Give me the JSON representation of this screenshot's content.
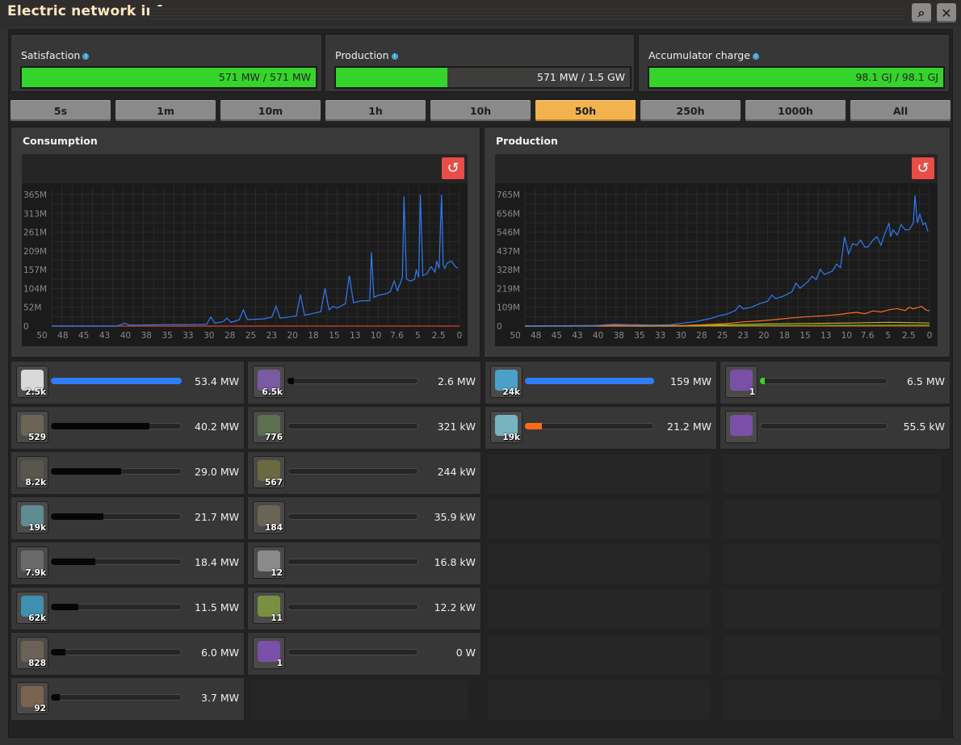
{
  "window": {
    "title": "Electric network info"
  },
  "toolbar": {
    "search_glyph": "⌕",
    "close_glyph": "✕"
  },
  "stats": {
    "satisfaction": {
      "label": "Satisfaction",
      "value": "571 MW / 571 MW",
      "fraction": 1.0
    },
    "production": {
      "label": "Production",
      "value": "571 MW / 1.5 GW",
      "fraction": 0.38
    },
    "accumulator": {
      "label": "Accumulator charge",
      "value": "98.1 GJ / 98.1 GJ",
      "fraction": 1.0
    }
  },
  "time_tabs": {
    "items": [
      "5s",
      "1m",
      "10m",
      "1h",
      "10h",
      "50h",
      "250h",
      "1000h",
      "All"
    ],
    "active": "50h"
  },
  "colors": {
    "accent_green": "#35d42a",
    "active_tab": "#f2b34e",
    "reset_red": "#e84d48",
    "line_blue": "#2f7cf6",
    "line_orange": "#ff6a1a",
    "line_yellow": "#c8b020",
    "line_green": "#5fbf2a"
  },
  "chart_data": [
    {
      "type": "line",
      "title": "Consumption",
      "xlabel": "",
      "ylabel": "",
      "x_tick_labels": [
        "50",
        "48",
        "45",
        "43",
        "40",
        "38",
        "35",
        "33",
        "30",
        "28",
        "25",
        "23",
        "20",
        "18",
        "15",
        "13",
        "10",
        "7.6",
        "5",
        "2.5",
        "0"
      ],
      "y_tick_labels": [
        "0",
        "52M",
        "104M",
        "157M",
        "209M",
        "261M",
        "313M",
        "365M"
      ],
      "xlim": [
        50,
        0
      ],
      "ylim": [
        0,
        365
      ],
      "grid": true,
      "series": [
        {
          "color": "#2f7cf6",
          "points": [
            [
              50,
              0
            ],
            [
              47,
              0
            ],
            [
              44,
              0
            ],
            [
              42,
              0
            ],
            [
              41,
              8
            ],
            [
              40.5,
              3
            ],
            [
              39,
              3
            ],
            [
              36,
              4
            ],
            [
              33,
              4
            ],
            [
              31,
              5
            ],
            [
              30.5,
              25
            ],
            [
              30,
              8
            ],
            [
              29,
              12
            ],
            [
              28.5,
              22
            ],
            [
              28,
              10
            ],
            [
              27,
              18
            ],
            [
              26.5,
              45
            ],
            [
              26,
              18
            ],
            [
              24,
              20
            ],
            [
              23,
              25
            ],
            [
              22.5,
              55
            ],
            [
              22,
              22
            ],
            [
              21,
              25
            ],
            [
              20,
              28
            ],
            [
              19.5,
              88
            ],
            [
              19,
              30
            ],
            [
              18,
              35
            ],
            [
              17,
              40
            ],
            [
              16.5,
              105
            ],
            [
              16,
              45
            ],
            [
              15.5,
              55
            ],
            [
              15,
              50
            ],
            [
              14,
              62
            ],
            [
              13.5,
              140
            ],
            [
              13,
              65
            ],
            [
              12,
              70
            ],
            [
              11.5,
              70
            ],
            [
              11,
              70
            ],
            [
              10.8,
              205
            ],
            [
              10.5,
              80
            ],
            [
              10,
              85
            ],
            [
              9,
              90
            ],
            [
              8.5,
              95
            ],
            [
              8,
              125
            ],
            [
              7.6,
              98
            ],
            [
              7,
              135
            ],
            [
              6.8,
              360
            ],
            [
              6.5,
              130
            ],
            [
              6,
              125
            ],
            [
              5.5,
              130
            ],
            [
              5.3,
              155
            ],
            [
              5,
              135
            ],
            [
              4.8,
              365
            ],
            [
              4.5,
              140
            ],
            [
              4,
              145
            ],
            [
              3.5,
              165
            ],
            [
              3,
              150
            ],
            [
              2.8,
              180
            ],
            [
              2.5,
              160
            ],
            [
              2.2,
              365
            ],
            [
              2,
              170
            ],
            [
              1.8,
              160
            ],
            [
              1.5,
              175
            ],
            [
              1,
              180
            ],
            [
              0.5,
              165
            ],
            [
              0.2,
              160
            ]
          ]
        }
      ]
    },
    {
      "type": "line",
      "title": "Production",
      "xlabel": "",
      "ylabel": "",
      "x_tick_labels": [
        "50",
        "48",
        "45",
        "43",
        "40",
        "38",
        "35",
        "33",
        "30",
        "28",
        "25",
        "23",
        "20",
        "18",
        "15",
        "13",
        "10",
        "7.6",
        "5",
        "2.5",
        "0"
      ],
      "y_tick_labels": [
        "0",
        "109M",
        "219M",
        "328M",
        "437M",
        "546M",
        "656M",
        "765M"
      ],
      "xlim": [
        50,
        0
      ],
      "ylim": [
        0,
        765
      ],
      "grid": true,
      "series": [
        {
          "color": "#2f7cf6",
          "points": [
            [
              50,
              0
            ],
            [
              42,
              0
            ],
            [
              40,
              8
            ],
            [
              39,
              10
            ],
            [
              36,
              8
            ],
            [
              34,
              6
            ],
            [
              32,
              8
            ],
            [
              30,
              20
            ],
            [
              29,
              25
            ],
            [
              28,
              35
            ],
            [
              27,
              45
            ],
            [
              26,
              60
            ],
            [
              25,
              70
            ],
            [
              24,
              90
            ],
            [
              23.5,
              120
            ],
            [
              23,
              100
            ],
            [
              22,
              110
            ],
            [
              21,
              130
            ],
            [
              20,
              145
            ],
            [
              19.5,
              180
            ],
            [
              19,
              160
            ],
            [
              18,
              175
            ],
            [
              17,
              200
            ],
            [
              16.5,
              250
            ],
            [
              16,
              220
            ],
            [
              15,
              260
            ],
            [
              14.5,
              290
            ],
            [
              14,
              270
            ],
            [
              13.5,
              330
            ],
            [
              13,
              300
            ],
            [
              12,
              320
            ],
            [
              11.5,
              360
            ],
            [
              11,
              340
            ],
            [
              10.5,
              520
            ],
            [
              10,
              420
            ],
            [
              9.5,
              480
            ],
            [
              9,
              470
            ],
            [
              8.5,
              500
            ],
            [
              8,
              460
            ],
            [
              7.6,
              460
            ],
            [
              7,
              500
            ],
            [
              6.5,
              520
            ],
            [
              6,
              470
            ],
            [
              5.5,
              540
            ],
            [
              5,
              600
            ],
            [
              4.8,
              520
            ],
            [
              4.5,
              560
            ],
            [
              4,
              530
            ],
            [
              3.5,
              590
            ],
            [
              3,
              560
            ],
            [
              2.5,
              560
            ],
            [
              2,
              600
            ],
            [
              1.8,
              760
            ],
            [
              1.5,
              600
            ],
            [
              1.2,
              650
            ],
            [
              1,
              620
            ],
            [
              0.8,
              590
            ],
            [
              0.5,
              600
            ],
            [
              0.2,
              550
            ]
          ]
        },
        {
          "color": "#ff6a1a",
          "points": [
            [
              50,
              0
            ],
            [
              30,
              4
            ],
            [
              28,
              8
            ],
            [
              25,
              15
            ],
            [
              23,
              25
            ],
            [
              21,
              30
            ],
            [
              19,
              38
            ],
            [
              17,
              48
            ],
            [
              15,
              55
            ],
            [
              13,
              60
            ],
            [
              11,
              68
            ],
            [
              10,
              75
            ],
            [
              9,
              80
            ],
            [
              8,
              72
            ],
            [
              7,
              88
            ],
            [
              6,
              82
            ],
            [
              5,
              95
            ],
            [
              4,
              102
            ],
            [
              3,
              90
            ],
            [
              2.5,
              110
            ],
            [
              2,
              100
            ],
            [
              1,
              115
            ],
            [
              0.5,
              95
            ],
            [
              0,
              88
            ]
          ]
        },
        {
          "color": "#c8b020",
          "points": [
            [
              50,
              0
            ],
            [
              30,
              2
            ],
            [
              25,
              8
            ],
            [
              20,
              12
            ],
            [
              15,
              15
            ],
            [
              10,
              18
            ],
            [
              5,
              22
            ],
            [
              2.5,
              20
            ],
            [
              0,
              18
            ]
          ]
        },
        {
          "color": "#5fbf2a",
          "points": [
            [
              50,
              0
            ],
            [
              38,
              4
            ],
            [
              36,
              0
            ],
            [
              30,
              1
            ],
            [
              20,
              3
            ],
            [
              10,
              4
            ],
            [
              5,
              5
            ],
            [
              0,
              5
            ]
          ]
        }
      ]
    }
  ],
  "consumption_rows": [
    {
      "icon": "radar-icon",
      "icon_color": "#d9d9d9",
      "count": "2.5k",
      "value": "53.4 MW",
      "fraction": 1.0,
      "bar_color": "#2f7cf6"
    },
    {
      "icon": "roboport-icon",
      "icon_color": "#6b6558",
      "count": "529",
      "value": "40.2 MW",
      "fraction": 0.75,
      "bar_color": "#060606"
    },
    {
      "icon": "electric-furnace-icon",
      "icon_color": "#5a564e",
      "count": "8.2k",
      "value": "29.0 MW",
      "fraction": 0.54,
      "bar_color": "#060606"
    },
    {
      "icon": "beacon-icon",
      "icon_color": "#5f8c90",
      "count": "19k",
      "value": "21.7 MW",
      "fraction": 0.4,
      "bar_color": "#060606"
    },
    {
      "icon": "assembler-icon",
      "icon_color": "#6a6a6a",
      "count": "7.9k",
      "value": "18.4 MW",
      "fraction": 0.34,
      "bar_color": "#060606"
    },
    {
      "icon": "stack-inserter-icon",
      "icon_color": "#3f8fb0",
      "count": "62k",
      "value": "11.5 MW",
      "fraction": 0.21,
      "bar_color": "#060606"
    },
    {
      "icon": "lab-icon",
      "icon_color": "#6b6154",
      "count": "828",
      "value": "6.0 MW",
      "fraction": 0.11,
      "bar_color": "#060606"
    },
    {
      "icon": "mining-drill-icon",
      "icon_color": "#7a6450",
      "count": "92",
      "value": "3.7 MW",
      "fraction": 0.07,
      "bar_color": "#060606"
    }
  ],
  "consumption_rows_2": [
    {
      "icon": "inserter-icon",
      "icon_color": "#7a5aa0",
      "count": "6.5k",
      "value": "2.6 MW",
      "fraction": 0.05,
      "bar_color": "#060606"
    },
    {
      "icon": "programmable-speaker-icon",
      "icon_color": "#5a7050",
      "count": "776",
      "value": "321 kW",
      "fraction": 0.0,
      "bar_color": "#060606"
    },
    {
      "icon": "arithmetic-combinator-icon",
      "icon_color": "#6a6a40",
      "count": "567",
      "value": "244 kW",
      "fraction": 0.0,
      "bar_color": "#060606"
    },
    {
      "icon": "pump-icon",
      "icon_color": "#6a6456",
      "count": "184",
      "value": "35.9 kW",
      "fraction": 0.0,
      "bar_color": "#060606"
    },
    {
      "icon": "filter-inserter-icon",
      "icon_color": "#8a8a8a",
      "count": "12",
      "value": "16.8 kW",
      "fraction": 0.0,
      "bar_color": "#060606"
    },
    {
      "icon": "fast-inserter-icon",
      "icon_color": "#7a9040",
      "count": "11",
      "value": "12.2 kW",
      "fraction": 0.0,
      "bar_color": "#060606"
    },
    {
      "icon": "accumulator-icon",
      "icon_color": "#7a4fa8",
      "count": "1",
      "value": "0 W",
      "fraction": 0.0,
      "bar_color": "#060606"
    }
  ],
  "production_rows": [
    {
      "icon": "solar-panel-icon",
      "icon_color": "#4aa0c8",
      "count": "24k",
      "value": "159 MW",
      "fraction": 1.0,
      "bar_color": "#2f7cf6"
    },
    {
      "icon": "steam-engine-icon",
      "icon_color": "#78b4c0",
      "count": "19k",
      "value": "21.2 MW",
      "fraction": 0.13,
      "bar_color": "#ff6a1a"
    }
  ],
  "production_rows_2": [
    {
      "icon": "accumulator-icon",
      "icon_color": "#7a4fa8",
      "count": "1",
      "value": "6.5 MW",
      "fraction": 0.04,
      "bar_color": "#35d42a"
    },
    {
      "icon": "accumulator-icon",
      "icon_color": "#7a4fa8",
      "count": "",
      "value": "55.5 kW",
      "fraction": 0.0,
      "bar_color": "#060606"
    }
  ]
}
